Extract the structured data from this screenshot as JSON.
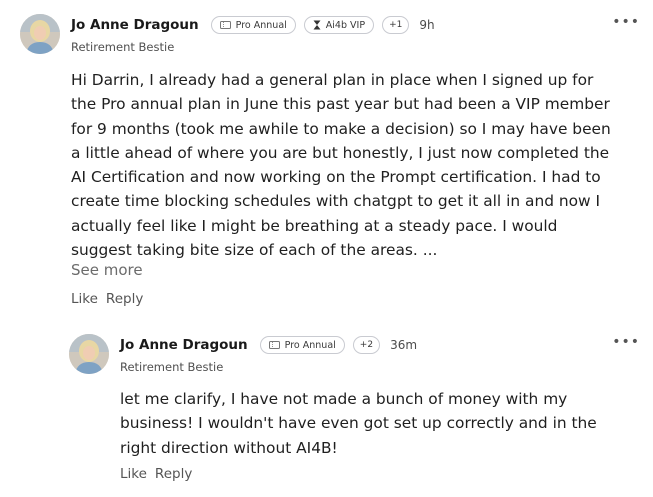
{
  "comments": [
    {
      "author": "Jo Anne Dragoun",
      "badges": [
        {
          "label": "Pro Annual",
          "icon": "ticket-icon"
        },
        {
          "label": "Ai4b VIP",
          "icon": "hourglass-icon"
        }
      ],
      "extra_badges": "+1",
      "time": "9h",
      "subtitle": "Retirement Bestie",
      "text": "Hi Darrin, I already had a general plan in place when I signed up for the Pro annual plan in June this past year but had been a VIP member for 9 months (took me awhile to make a decision) so I may have been a little ahead of where you are but honestly, I just now completed the AI Certification and now working on the Prompt certification.  I had to create time blocking schedules with chatgpt to get it all in and now I actually feel like I might be breathing at a steady pace.  I would suggest taking bite size of each of the areas. ...",
      "see_more": "See more",
      "like": "Like",
      "reply": "Reply",
      "menu": "•••"
    },
    {
      "author": "Jo Anne Dragoun",
      "badges": [
        {
          "label": "Pro Annual",
          "icon": "ticket-icon"
        }
      ],
      "extra_badges": "+2",
      "time": "36m",
      "subtitle": "Retirement Bestie",
      "text": "let me clarify, I have not made a bunch of money with my business! I wouldn't have even got set up correctly and in the right direction without AI4B!",
      "like": "Like",
      "reply": "Reply",
      "menu": "•••"
    }
  ]
}
